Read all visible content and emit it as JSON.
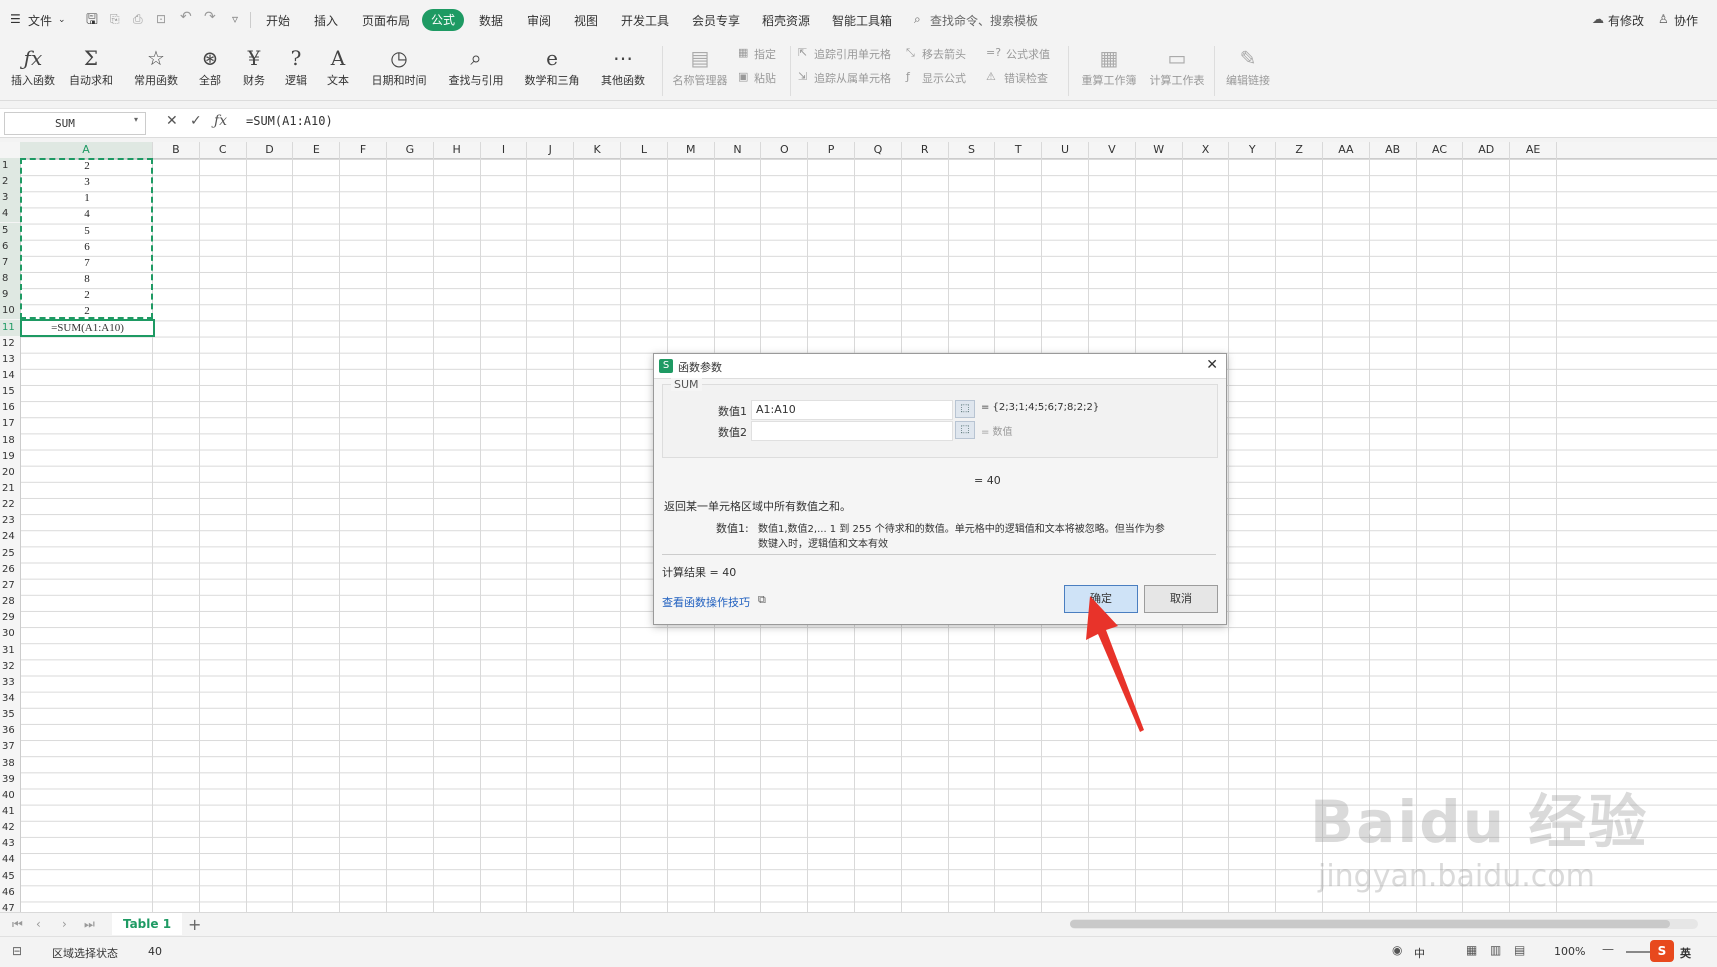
{
  "menubar": {
    "file_label": "文件",
    "tabs": [
      "开始",
      "插入",
      "页面布局",
      "公式",
      "数据",
      "审阅",
      "视图",
      "开发工具",
      "会员专享",
      "稻壳资源",
      "智能工具箱"
    ],
    "search_placeholder": "查找命令、搜索模板",
    "right_items": [
      "有修改",
      "协作"
    ]
  },
  "ribbon": {
    "main_buttons": [
      {
        "icon": "fx-icon",
        "glyph": "ƒx",
        "label": "插入函数"
      },
      {
        "icon": "sigma-icon",
        "glyph": "Σ",
        "label": "自动求和"
      },
      {
        "icon": "star-icon",
        "glyph": "☆",
        "label": "常用函数"
      },
      {
        "icon": "asterisk-icon",
        "glyph": "⊛",
        "label": "全部"
      },
      {
        "icon": "yen-icon",
        "glyph": "¥",
        "label": "财务"
      },
      {
        "icon": "question-icon",
        "glyph": "?",
        "label": "逻辑"
      },
      {
        "icon": "text-a-icon",
        "glyph": "A",
        "label": "文本"
      },
      {
        "icon": "clock-icon",
        "glyph": "◷",
        "label": "日期和时间"
      },
      {
        "icon": "lookup-icon",
        "glyph": "⌕",
        "label": "查找与引用"
      },
      {
        "icon": "math-icon",
        "glyph": "e",
        "label": "数学和三角"
      },
      {
        "icon": "more-icon",
        "glyph": "⋯",
        "label": "其他函数"
      }
    ],
    "name_manager": "名称管理器",
    "specify": "指定",
    "paste": "粘贴",
    "trace_precedents": "追踪引用单元格",
    "trace_dependents": "追踪从属单元格",
    "remove_arrows": "移去箭头",
    "show_formulas": "显示公式",
    "eval_formula": "公式求值",
    "error_check": "错误检查",
    "recalc_workbook": "重算工作簿",
    "calc_sheet": "计算工作表",
    "edit_links": "编辑链接"
  },
  "formula_bar": {
    "name_box": "SUM",
    "formula": "=SUM(A1:A10)"
  },
  "grid": {
    "columns": [
      "A",
      "B",
      "C",
      "D",
      "E",
      "F",
      "G",
      "H",
      "I",
      "J",
      "K",
      "L",
      "M",
      "N",
      "O",
      "P",
      "Q",
      "R",
      "S",
      "T",
      "U",
      "V",
      "W",
      "X",
      "Y",
      "Z",
      "AA",
      "AB",
      "AC",
      "AD",
      "AE"
    ],
    "cells_a": [
      "2",
      "3",
      "1",
      "4",
      "5",
      "6",
      "7",
      "8",
      "2",
      "2",
      "=SUM(A1:A10)"
    ]
  },
  "dialog": {
    "title": "函数参数",
    "function_name": "SUM",
    "arg1_label": "数值1",
    "arg1_value": "A1:A10",
    "arg1_result": "= {2;3;1;4;5;6;7;8;2;2}",
    "arg2_label": "数值2",
    "arg2_result": "= 数值",
    "eq_result": "= 40",
    "description": "返回某一单元格区域中所有数值之和。",
    "arg_desc_label": "数值1:",
    "arg_desc_line1": "数值1,数值2,... 1 到 255 个待求和的数值。单元格中的逻辑值和文本将被忽略。但当作为参",
    "arg_desc_line2": "数键入时，逻辑值和文本有效",
    "calc_result": "计算结果 = 40",
    "help_link": "查看函数操作技巧",
    "ok": "确定",
    "cancel": "取消"
  },
  "sheet_tabs": {
    "active": "Table 1"
  },
  "status": {
    "mode": "区域选择状态",
    "value": "40",
    "zoom": "100%",
    "input_lang": "中",
    "ime_lang": "英"
  },
  "watermark": {
    "line1": "Baidu 经验",
    "line2": "jingyan.baidu.com"
  },
  "colors": {
    "accent": "#1e9a63",
    "arrow": "#e8332a",
    "link": "#1f5fbf"
  }
}
